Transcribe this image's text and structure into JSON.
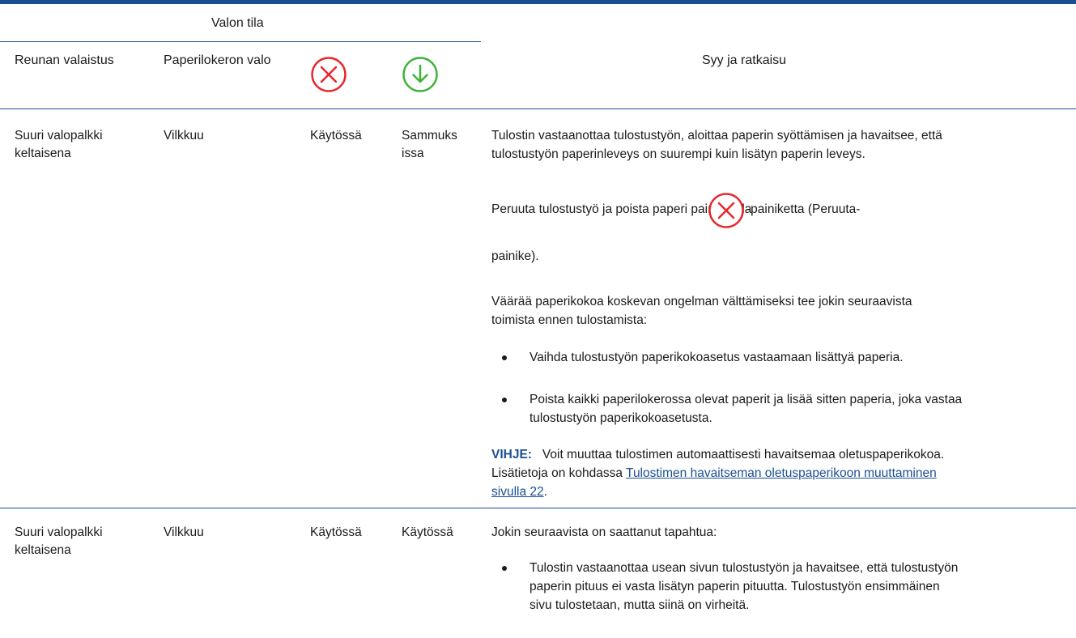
{
  "header": {
    "light_state_group": "Valon tila",
    "col_edge_lighting": "Reunan valaistus",
    "col_tray_light": "Paperilokeron valo",
    "col_cause_solution": "Syy ja ratkaisu",
    "cancel_icon": "cancel-x-icon",
    "resume_icon": "resume-arrow-down-icon"
  },
  "rows": [
    {
      "edge_lighting": "Suuri valopalkki keltaisena",
      "tray_light": "Vilkkuu",
      "cancel_state": "Käytössä",
      "resume_state": "Sammukissa",
      "resume_state_line1": "Sammuks",
      "resume_state_line2": "issa",
      "cause_line1": "Tulostin vastaanottaa tulostustyön, aloittaa paperin syöttämisen ja havaitsee, että",
      "cause_line2": "tulostustyön paperinleveys on suurempi kuin lisätyn paperin leveys.",
      "cancel_instruction_before": "Peruuta tulostustyö ja poista paperi painamalla",
      "cancel_instruction_after": "-painiketta (Peruuta-",
      "cancel_instruction_end": "painike).",
      "avoid_line1": "Väärää paperikokoa koskevan ongelman välttämiseksi tee jokin seuraavista",
      "avoid_line2": "toimista ennen tulostamista:",
      "bullet1": "Vaihda tulostustyön paperikokoasetus vastaamaan lisättyä paperia.",
      "bullet2_line1": "Poista kaikki paperilokerossa olevat paperit ja lisää sitten paperia, joka vastaa",
      "bullet2_line2": "tulostustyön paperikokoasetusta.",
      "tip_label": "VIHJE:",
      "tip_line1": "Voit muuttaa tulostimen automaattisesti havaitsemaa oletuspaperikokoa.",
      "tip_line2_prefix": "Lisätietoja on kohdassa",
      "tip_link_line1": "Tulostimen havaitseman oletuspaperikoon muuttaminen",
      "tip_link_line2": "sivulla 22",
      "tip_end": "."
    },
    {
      "edge_lighting_line1": "Suuri valopalkki",
      "edge_lighting_line2": "keltaisena",
      "tray_light": "Vilkkuu",
      "cancel_state": "Käytössä",
      "resume_state": "Käytössä",
      "cause_intro": "Jokin seuraavista on saattanut tapahtua:",
      "bullet1_line1": "Tulostin vastaanottaa usean sivun tulostustyön ja havaitsee, että tulostustyön",
      "bullet1_line2": "paperin pituus ei vasta lisätyn paperin pituutta. Tulostustyön ensimmäinen",
      "bullet1_line3": "sivu tulostetaan, mutta siinä on virheitä."
    }
  ],
  "colors": {
    "rule": "#1b4f92",
    "cancel_red": "#e8262c",
    "resume_green": "#3db339"
  }
}
